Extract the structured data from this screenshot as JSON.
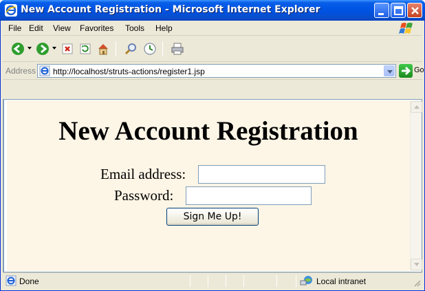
{
  "window": {
    "title": "New Account Registration - Microsoft Internet Explorer",
    "controls": [
      "minimize-icon",
      "maximize-icon",
      "close-icon"
    ],
    "title_color": "#0055e5"
  },
  "menubar": {
    "items": [
      {
        "label": "File"
      },
      {
        "label": "Edit"
      },
      {
        "label": "View"
      },
      {
        "label": "Favorites"
      },
      {
        "label": "Tools"
      },
      {
        "label": "Help"
      }
    ]
  },
  "toolbar": {
    "icons": [
      "back-icon",
      "forward-icon",
      "stop-icon",
      "refresh-icon",
      "home-icon",
      "search-icon",
      "history-icon",
      "print-icon"
    ]
  },
  "address_bar": {
    "label": "Address",
    "url": "http://localhost/struts-actions/register1.jsp",
    "go_label": "Go"
  },
  "page": {
    "heading": "New Account Registration",
    "email_label": "Email address:",
    "email_value": "",
    "password_label": "Password:",
    "password_value": "",
    "submit_label": "Sign Me Up!",
    "background": "#fdf5e6"
  },
  "statusbar": {
    "status": "Done",
    "zone": "Local intranet"
  }
}
